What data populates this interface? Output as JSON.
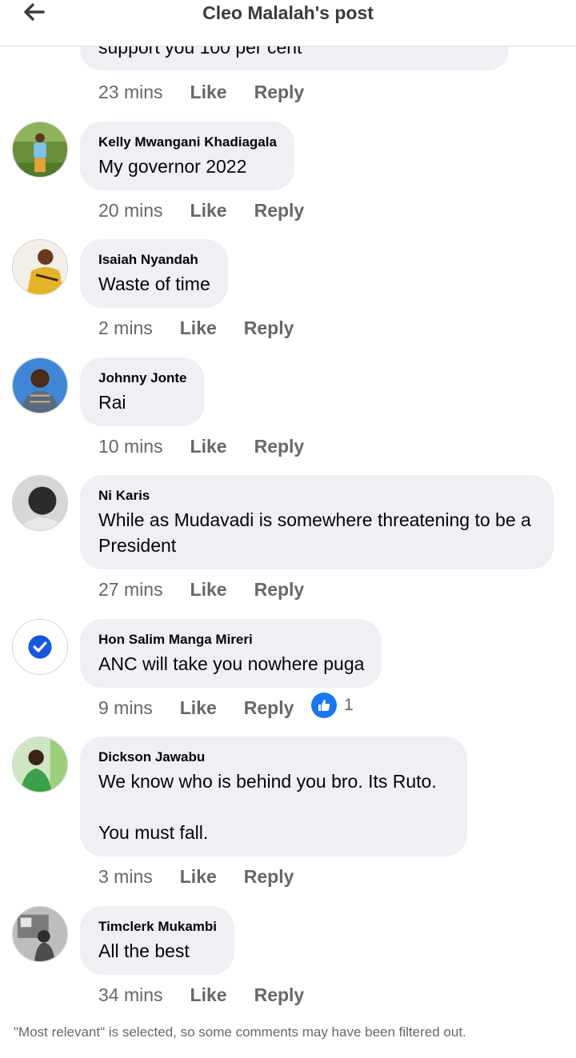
{
  "header": {
    "title": "Cleo Malalah's post"
  },
  "partial_comment": {
    "text": "support you 100 per cent"
  },
  "first_meta": {
    "time": "23 mins",
    "like": "Like",
    "reply": "Reply"
  },
  "comments": [
    {
      "name": "Kelly Mwangani Khadiagala",
      "text": "My governor 2022",
      "time": "20 mins",
      "like": "Like",
      "reply": "Reply",
      "avatar": "user-photo-icon"
    },
    {
      "name": "Isaiah Nyandah",
      "text": "Waste of time",
      "time": "2 mins",
      "like": "Like",
      "reply": "Reply",
      "avatar": "user-photo-icon"
    },
    {
      "name": "Johnny Jonte",
      "text": "Rai",
      "time": "10 mins",
      "like": "Like",
      "reply": "Reply",
      "avatar": "user-photo-icon"
    },
    {
      "name": "Ni Karis",
      "text": "While as Mudavadi is somewhere threatening to be a President",
      "time": "27 mins",
      "like": "Like",
      "reply": "Reply",
      "avatar": "user-photo-icon"
    },
    {
      "name": "Hon Salim Manga Mireri",
      "text": "ANC will take you nowhere puga",
      "time": "9 mins",
      "like": "Like",
      "reply": "Reply",
      "avatar": "check-badge-icon",
      "reactions": {
        "icon": "thumbs-up-icon",
        "count": "1"
      }
    },
    {
      "name": "Dickson Jawabu",
      "text": "We know who is behind you bro. Its Ruto.\n\nYou must fall.",
      "time": "3 mins",
      "like": "Like",
      "reply": "Reply",
      "avatar": "user-photo-icon"
    },
    {
      "name": "Timclerk Mukambi",
      "text": "All the best",
      "time": "34 mins",
      "like": "Like",
      "reply": "Reply",
      "avatar": "user-photo-icon"
    }
  ],
  "footer": {
    "note": "\"Most relevant\" is selected, so some comments may have been filtered out."
  },
  "colors": {
    "bubble": "#eff0f4",
    "meta_text": "#65676b",
    "accent_blue": "#1877f2"
  }
}
